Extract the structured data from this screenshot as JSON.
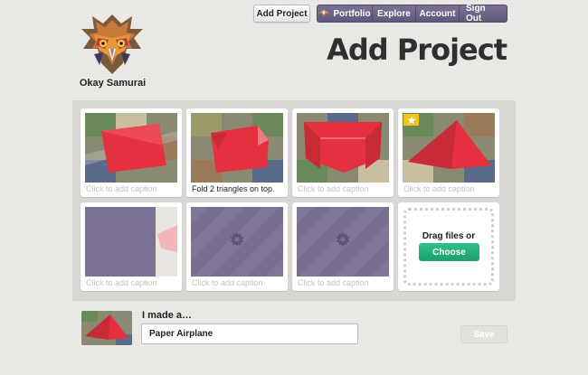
{
  "header": {
    "add_project_label": "Add Project",
    "nav": {
      "portfolio": "Portfolio",
      "explore": "Explore",
      "account": "Account",
      "sign_out": "Sign Out"
    }
  },
  "brand": {
    "name": "Okay Samurai"
  },
  "page": {
    "title": "Add Project"
  },
  "photos": [
    {
      "caption": "",
      "placeholder": "Click to add caption",
      "starred": false,
      "state": "image"
    },
    {
      "caption": "Fold 2 triangles on top.",
      "placeholder": "Click to add caption",
      "starred": false,
      "state": "image"
    },
    {
      "caption": "",
      "placeholder": "Click to add caption",
      "starred": false,
      "state": "image"
    },
    {
      "caption": "",
      "placeholder": "Click to add caption",
      "starred": true,
      "state": "image"
    },
    {
      "caption": "",
      "placeholder": "Click to add caption",
      "starred": false,
      "state": "uploading"
    },
    {
      "caption": "",
      "placeholder": "Click to add caption",
      "starred": false,
      "state": "processing"
    },
    {
      "caption": "",
      "placeholder": "Click to add caption",
      "starred": false,
      "state": "processing"
    }
  ],
  "upload": {
    "drag_label": "Drag files or",
    "choose_label": "Choose"
  },
  "made": {
    "label": "I made a…",
    "value": "Paper Airplane",
    "save_label": "Save"
  },
  "colors": {
    "nav": "#6b6489",
    "accent": "#22a878",
    "placeholder": "#7b7195",
    "paper": "#e5313f",
    "star": "#f2c21d"
  }
}
